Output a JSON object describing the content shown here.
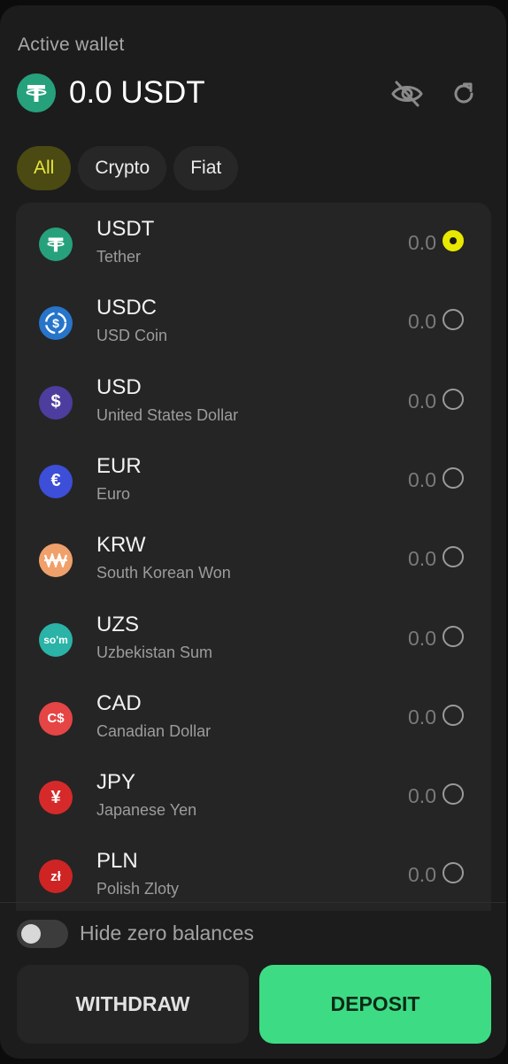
{
  "wallet": {
    "label": "Active wallet",
    "balance": "0.0 USDT",
    "coin_icon": "tether-icon",
    "actions": [
      "eye-off-icon",
      "refresh-icon"
    ]
  },
  "filters": [
    {
      "label": "All",
      "active": true
    },
    {
      "label": "Crypto",
      "active": false
    },
    {
      "label": "Fiat",
      "active": false
    }
  ],
  "currencies": [
    {
      "code": "USDT",
      "name": "Tether",
      "amount": "0.0",
      "icon": "tether-icon",
      "color": "#26a17b",
      "glyph": "",
      "selected": true
    },
    {
      "code": "USDC",
      "name": "USD Coin",
      "amount": "0.0",
      "icon": "usdc-icon",
      "color": "#2775ca",
      "glyph": "",
      "selected": false
    },
    {
      "code": "USD",
      "name": "United States Dollar",
      "amount": "0.0",
      "icon": "dollar-icon",
      "color": "#4d3d9e",
      "glyph": "$",
      "selected": false
    },
    {
      "code": "EUR",
      "name": "Euro",
      "amount": "0.0",
      "icon": "euro-icon",
      "color": "#3d4ed8",
      "glyph": "€",
      "selected": false
    },
    {
      "code": "KRW",
      "name": "South Korean Won",
      "amount": "0.0",
      "icon": "won-icon",
      "color": "#f0a06a",
      "glyph": "",
      "selected": false
    },
    {
      "code": "UZS",
      "name": "Uzbekistan Sum",
      "amount": "0.0",
      "icon": "sum-icon",
      "color": "#2ab3a6",
      "glyph": "so'm",
      "selected": false
    },
    {
      "code": "CAD",
      "name": "Canadian Dollar",
      "amount": "0.0",
      "icon": "canadian-dollar-icon",
      "color": "#e64545",
      "glyph": "C$",
      "selected": false
    },
    {
      "code": "JPY",
      "name": "Japanese Yen",
      "amount": "0.0",
      "icon": "yen-icon",
      "color": "#d62a2a",
      "glyph": "¥",
      "selected": false
    },
    {
      "code": "PLN",
      "name": "Polish Zloty",
      "amount": "0.0",
      "icon": "zloty-icon",
      "color": "#cf2424",
      "glyph": "zł",
      "selected": false
    }
  ],
  "hide_zero": {
    "label": "Hide zero balances",
    "on": false
  },
  "buttons": {
    "withdraw": "WITHDRAW",
    "deposit": "DEPOSIT"
  },
  "colors": {
    "accent": "#e8e800",
    "deposit": "#3ddc84",
    "tether": "#26a17b"
  }
}
